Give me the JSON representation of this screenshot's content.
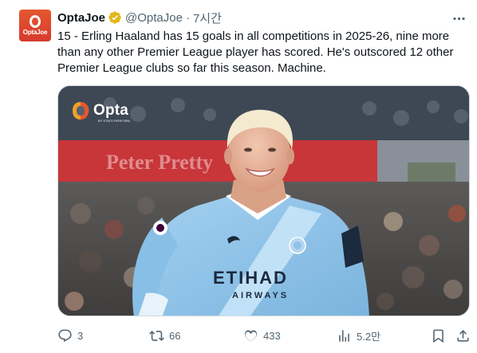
{
  "tweet": {
    "display_name": "OptaJoe",
    "handle": "@OptaJoe",
    "separator": "·",
    "time": "7시간",
    "avatar_text": "OptaJoe",
    "text": "15 - Erling Haaland has 15 goals in all competitions in 2025-26, nine more than any other Premier League player has scored. He's outscored 12 other Premier League clubs so far this season. Machine.",
    "media": {
      "watermark": "Opta",
      "watermark_sub": "BY STATS PERFORM",
      "jersey_sponsor": "ETIHAD",
      "jersey_sponsor_sub": "AIRWAYS",
      "board_text": "Peter Pretty"
    }
  },
  "actions": {
    "replies": "3",
    "reposts": "66",
    "likes": "433",
    "views": "5.2만"
  },
  "colors": {
    "text": "#0f1419",
    "secondary": "#536471",
    "verified_gold": "#e2b719",
    "brand_orange": "#e5572e",
    "kit_blue": "#8ec3ea"
  },
  "icons": [
    "verified-badge-icon",
    "more-icon",
    "reply-icon",
    "repost-icon",
    "like-icon",
    "views-icon",
    "bookmark-icon",
    "share-icon"
  ]
}
